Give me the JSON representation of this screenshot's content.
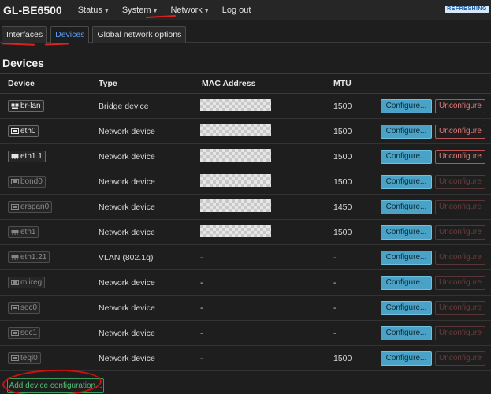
{
  "header": {
    "brand": "GL-BE6500",
    "menu": [
      {
        "label": "Status",
        "caret": true
      },
      {
        "label": "System",
        "caret": true
      },
      {
        "label": "Network",
        "caret": true
      },
      {
        "label": "Log out",
        "caret": false
      }
    ],
    "refresh_label": "REFRESHING"
  },
  "tabs": [
    {
      "label": "Interfaces"
    },
    {
      "label": "Devices"
    },
    {
      "label": "Global network options"
    }
  ],
  "active_tab": "Devices",
  "section_title": "Devices",
  "table": {
    "columns": [
      "Device",
      "Type",
      "MAC Address",
      "MTU"
    ],
    "rows": [
      {
        "device": "br-lan",
        "icon": "bridge-icon",
        "type": "Bridge device",
        "mac": "redacted",
        "mtu": "1500",
        "configure": "Configure...",
        "unconfigure": "Unconfigure",
        "unconfigure_enabled": true,
        "active": true
      },
      {
        "device": "eth0",
        "icon": "ethernet-port-icon",
        "type": "Network device",
        "mac": "redacted",
        "mtu": "1500",
        "configure": "Configure...",
        "unconfigure": "Unconfigure",
        "unconfigure_enabled": true,
        "active": true
      },
      {
        "device": "eth1.1",
        "icon": "switch-icon",
        "type": "Network device",
        "mac": "redacted",
        "mtu": "1500",
        "configure": "Configure...",
        "unconfigure": "Unconfigure",
        "unconfigure_enabled": true,
        "active": true
      },
      {
        "device": "bond0",
        "icon": "ethernet-port-icon",
        "type": "Network device",
        "mac": "redacted",
        "mtu": "1500",
        "configure": "Configure...",
        "unconfigure": "Unconfigure",
        "unconfigure_enabled": false,
        "active": false
      },
      {
        "device": "erspan0",
        "icon": "ethernet-port-icon",
        "type": "Network device",
        "mac": "redacted",
        "mtu": "1450",
        "configure": "Configure...",
        "unconfigure": "Unconfigure",
        "unconfigure_enabled": false,
        "active": false
      },
      {
        "device": "eth1",
        "icon": "switch-icon",
        "type": "Network device",
        "mac": "redacted",
        "mtu": "1500",
        "configure": "Configure...",
        "unconfigure": "Unconfigure",
        "unconfigure_enabled": false,
        "active": false
      },
      {
        "device": "eth1.21",
        "icon": "switch-icon",
        "type": "VLAN (802.1q)",
        "mac": "-",
        "mtu": "-",
        "configure": "Configure...",
        "unconfigure": "Unconfigure",
        "unconfigure_enabled": false,
        "active": false
      },
      {
        "device": "miireg",
        "icon": "ethernet-port-icon",
        "type": "Network device",
        "mac": "-",
        "mtu": "-",
        "configure": "Configure...",
        "unconfigure": "Unconfigure",
        "unconfigure_enabled": false,
        "active": false
      },
      {
        "device": "soc0",
        "icon": "ethernet-port-icon",
        "type": "Network device",
        "mac": "-",
        "mtu": "-",
        "configure": "Configure...",
        "unconfigure": "Unconfigure",
        "unconfigure_enabled": false,
        "active": false
      },
      {
        "device": "soc1",
        "icon": "ethernet-port-icon",
        "type": "Network device",
        "mac": "-",
        "mtu": "-",
        "configure": "Configure...",
        "unconfigure": "Unconfigure",
        "unconfigure_enabled": false,
        "active": false
      },
      {
        "device": "teql0",
        "icon": "ethernet-port-icon",
        "type": "Network device",
        "mac": "-",
        "mtu": "1500",
        "configure": "Configure...",
        "unconfigure": "Unconfigure",
        "unconfigure_enabled": false,
        "active": false
      }
    ]
  },
  "add_button_label": "Add device configuration...",
  "colors": {
    "background": "#1e1e1e",
    "configure_button": "#4aa3c6",
    "unconfigure_border": "#b85454",
    "add_button": "#4fbf73",
    "annotation_red": "#cc1111",
    "active_tab_text": "#5b9ef0"
  }
}
